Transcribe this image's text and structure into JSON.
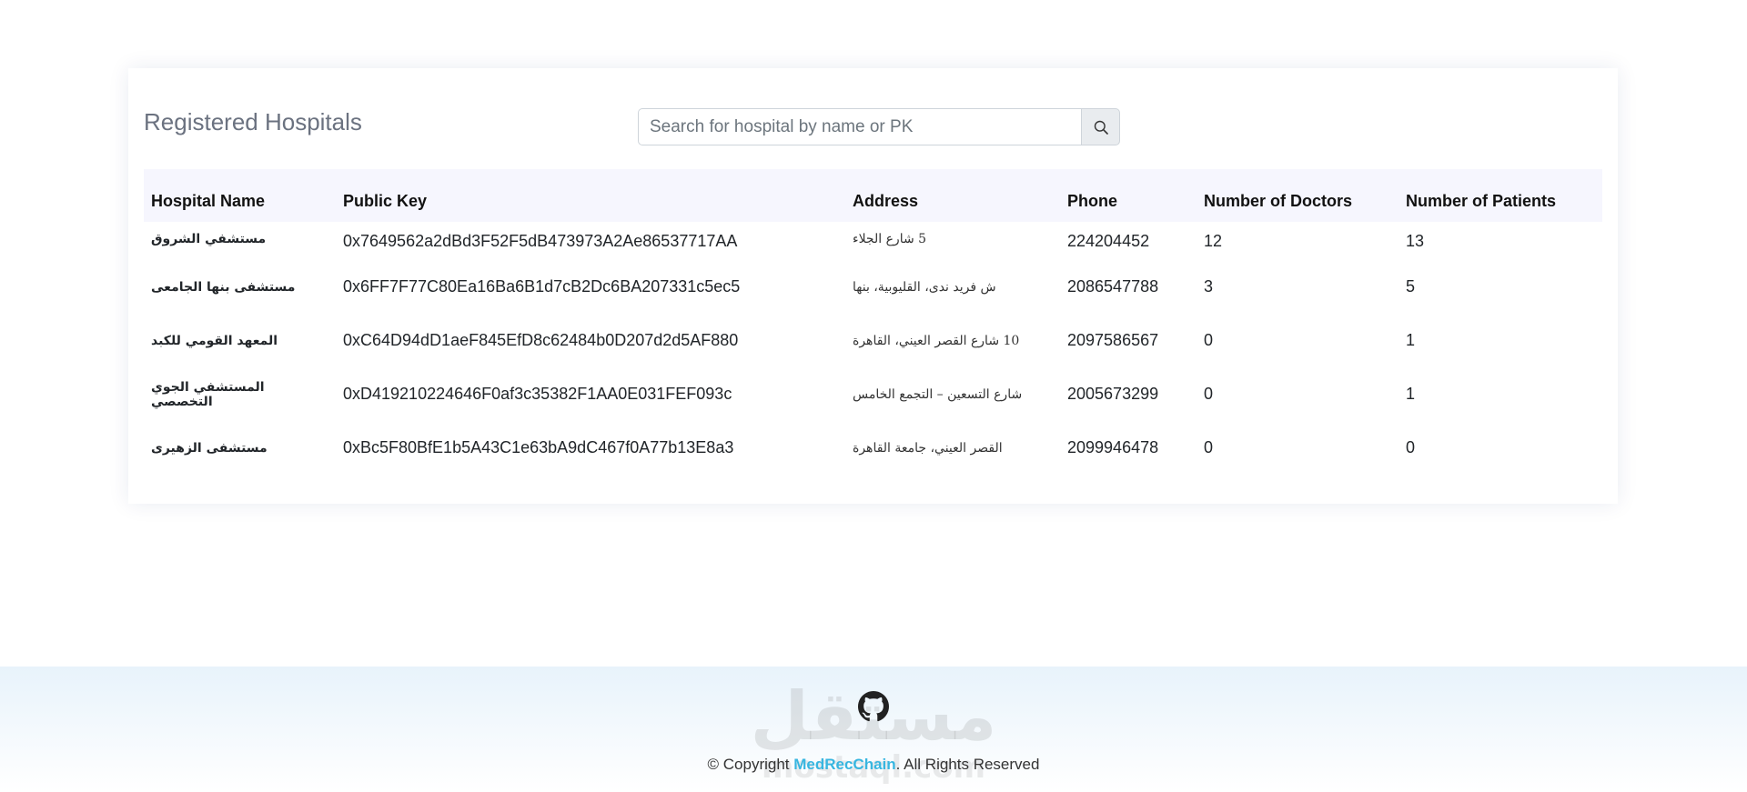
{
  "card": {
    "title": "Registered Hospitals",
    "search_placeholder": "Search for hospital by name or PK"
  },
  "table": {
    "headers": [
      "Hospital Name",
      "Public Key",
      "Address",
      "Phone",
      "Number of Doctors",
      "Number of Patients"
    ],
    "rows": [
      {
        "name": "مستشفي الشروق",
        "pk": "0x7649562a2dBd3F52F5dB473973A2Ae86537717AA",
        "address": "5 شارع الجلاء",
        "phone": "224204452",
        "doctors": "12",
        "patients": "13"
      },
      {
        "name": "مستشفى بنها الجامعى",
        "pk": "0x6FF7F77C80Ea16Ba6B1d7cB2Dc6BA207331c5ec5",
        "address": "ش فريد ندى، القليوبية، بنها",
        "phone": "2086547788",
        "doctors": "3",
        "patients": "5"
      },
      {
        "name": "المعهد القومي للكبد",
        "pk": "0xC64D94dD1aeF845EfD8c62484b0D207d2d5AF880",
        "address": "10 شارع القصر العيني، القاهرة",
        "phone": "2097586567",
        "doctors": "0",
        "patients": "1"
      },
      {
        "name": "المستشفي الجوي التخصصي",
        "pk": "0xD419210224646F0af3c35382F1AA0E031FEF093c",
        "address": "شارع التسعين – التجمع الخامس",
        "phone": "2005673299",
        "doctors": "0",
        "patients": "1"
      },
      {
        "name": "مستشفى الزهيرى",
        "pk": "0xBc5F80BfE1b5A43C1e63bA9dC467f0A77b13E8a3",
        "address": "القصر العيني، جامعة القاهرة",
        "phone": "2099946478",
        "doctors": "0",
        "patients": "0"
      }
    ]
  },
  "footer": {
    "watermark": "مستقل",
    "watermark_sub": "mostaql.com",
    "copyright_prefix": "© Copyright ",
    "brand": "MedRecChain",
    "copyright_suffix": ". All Rights Reserved"
  },
  "icons": {
    "search": "search-icon",
    "github": "github-icon"
  },
  "colors": {
    "brand": "#38b6e0",
    "header_bg": "#f6f6fe",
    "title": "#6b7280"
  }
}
